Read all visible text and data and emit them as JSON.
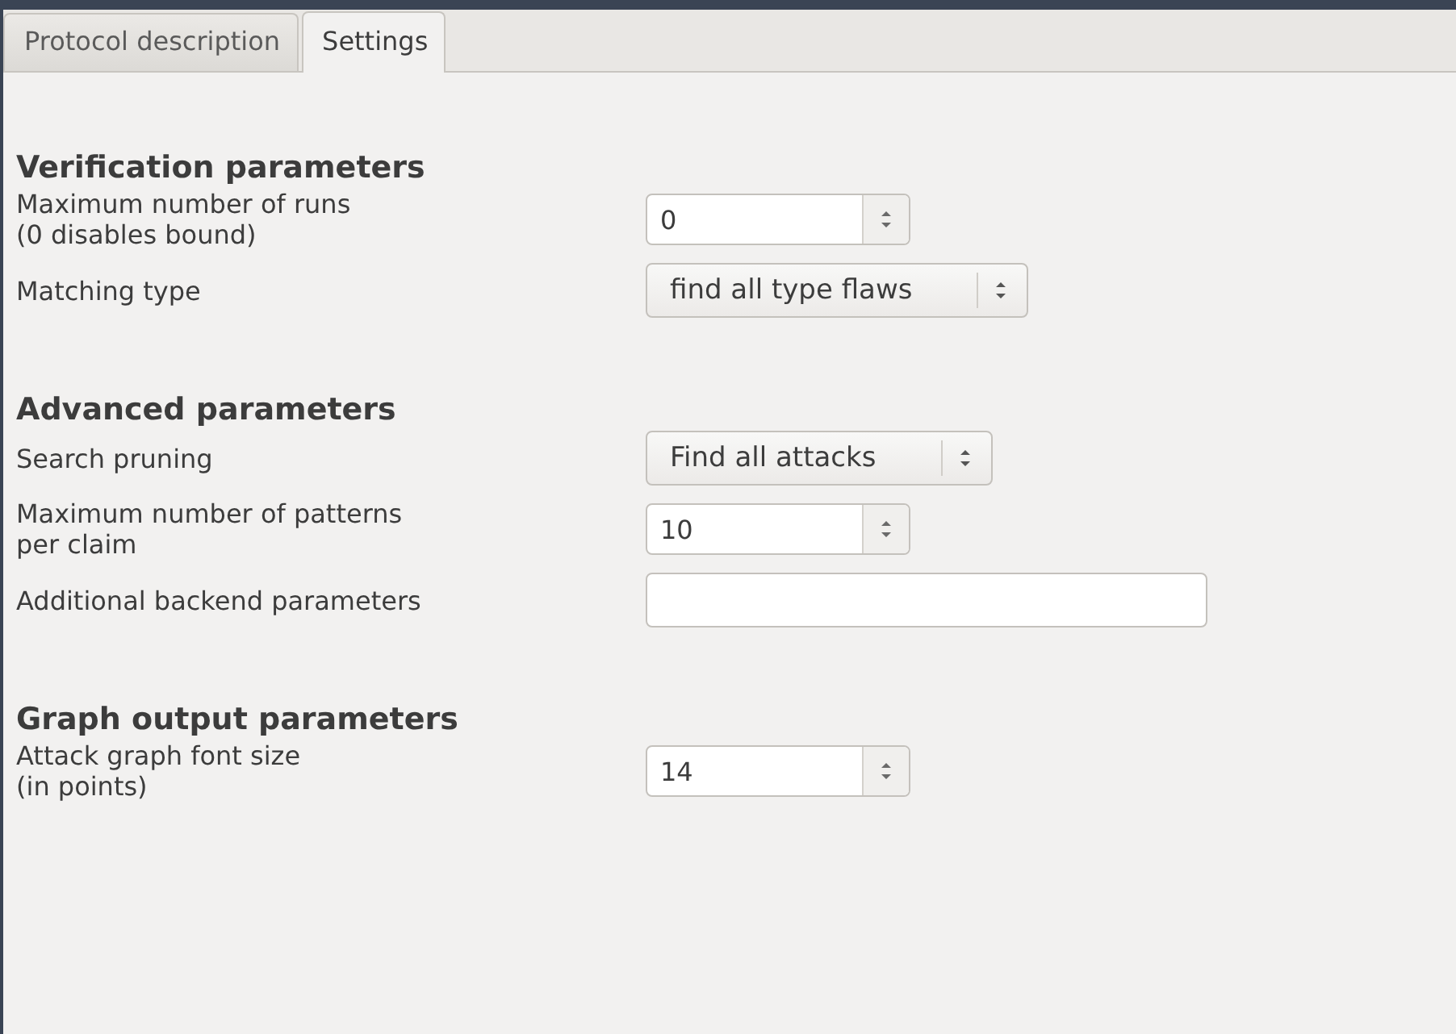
{
  "tabs": [
    {
      "label": "Protocol description",
      "selected": false
    },
    {
      "label": "Settings",
      "selected": true
    }
  ],
  "sections": [
    {
      "heading": "Verification parameters",
      "fields": [
        {
          "kind": "spin",
          "label": [
            "Maximum number of runs",
            "(0 disables bound)"
          ],
          "value": "0"
        },
        {
          "kind": "combo",
          "label": [
            "Matching type"
          ],
          "value": "find all type flaws"
        }
      ]
    },
    {
      "heading": "Advanced parameters",
      "fields": [
        {
          "kind": "combo",
          "label": [
            "Search pruning"
          ],
          "value": "Find all attacks"
        },
        {
          "kind": "spin",
          "label": [
            "Maximum number of patterns",
            "per claim"
          ],
          "value": "10"
        },
        {
          "kind": "text",
          "label": [
            "Additional backend parameters"
          ]
        }
      ]
    },
    {
      "heading": "Graph output parameters",
      "fields": [
        {
          "kind": "spin",
          "label": [
            "Attack graph font size",
            "(in points)"
          ],
          "value": "14"
        }
      ]
    }
  ]
}
